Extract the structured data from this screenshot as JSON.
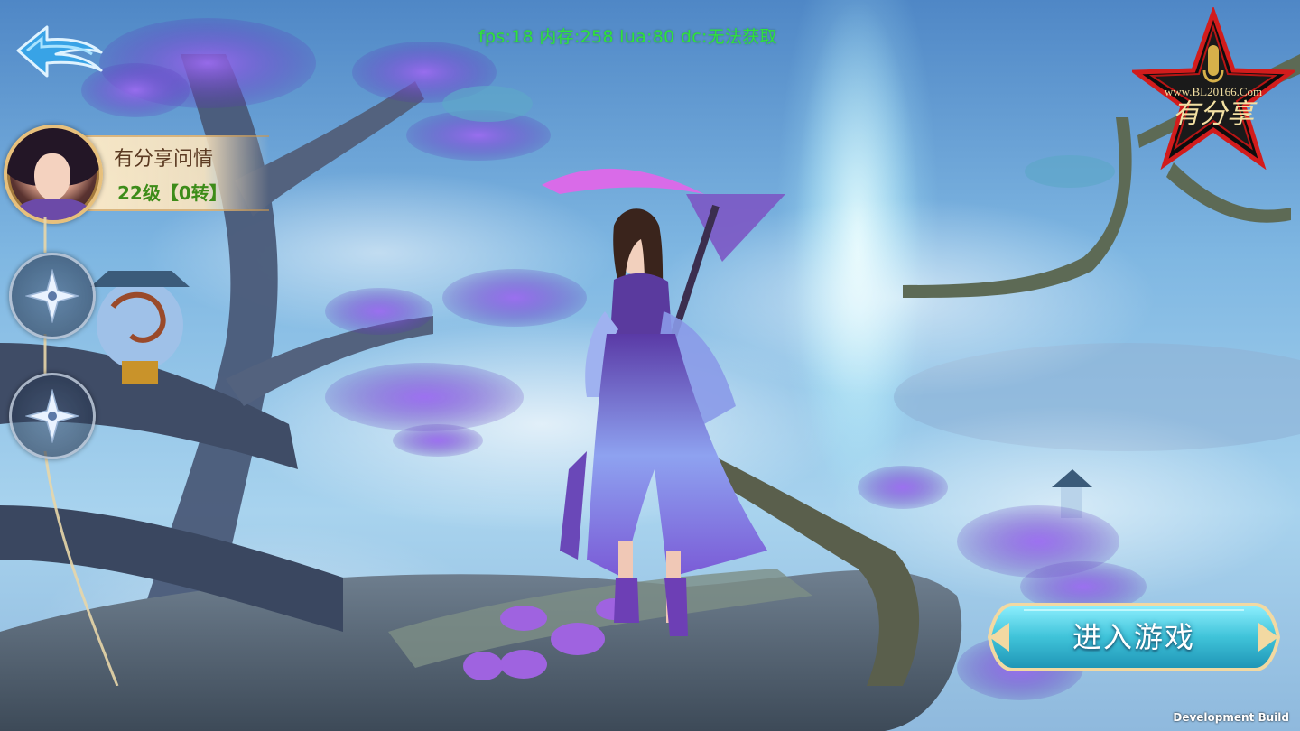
{
  "debug": {
    "text": "fps:18 内存:258 lua:80 dc:无法获取"
  },
  "player": {
    "name": "有分享问情",
    "level": "22级【0转】"
  },
  "enter_button": {
    "label": "进入游戏"
  },
  "build": {
    "label": "Development Build"
  },
  "logo": {
    "url_text": "www.BL20166.Com",
    "title": "有分享"
  },
  "icons": {
    "back": "back-arrow-icon",
    "slot_1": "four-point-star-icon",
    "slot_2": "four-point-star-icon"
  },
  "colors": {
    "debug_text": "#2fe33a",
    "level_text": "#3d8c19",
    "name_text": "#5b3a22",
    "button_fill": "#3fc3d9"
  }
}
